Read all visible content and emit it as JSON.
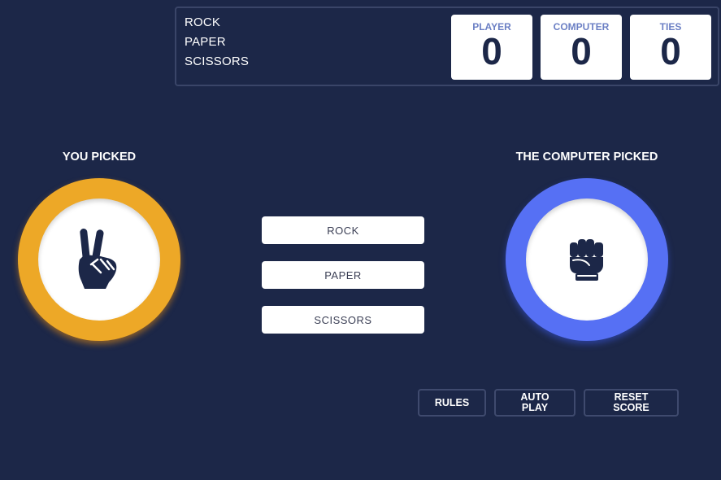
{
  "header": {
    "title_words": [
      "ROCK",
      "PAPER",
      "SCISSORS"
    ],
    "scores": [
      {
        "label": "PLAYER",
        "value": "0"
      },
      {
        "label": "COMPUTER",
        "value": "0"
      },
      {
        "label": "TIES",
        "value": "0"
      }
    ]
  },
  "player": {
    "title": "YOU PICKED",
    "choice_icon": "peace-hand-icon",
    "ring_color": "#eda827"
  },
  "computer": {
    "title": "THE COMPUTER PICKED",
    "choice_icon": "fist-icon",
    "ring_color": "#5670f4"
  },
  "choices": [
    "ROCK",
    "PAPER",
    "SCISSORS"
  ],
  "controls": {
    "rules": "RULES",
    "auto_play": [
      "AUTO",
      "PLAY"
    ],
    "reset_score": [
      "RESET",
      "SCORE"
    ]
  }
}
